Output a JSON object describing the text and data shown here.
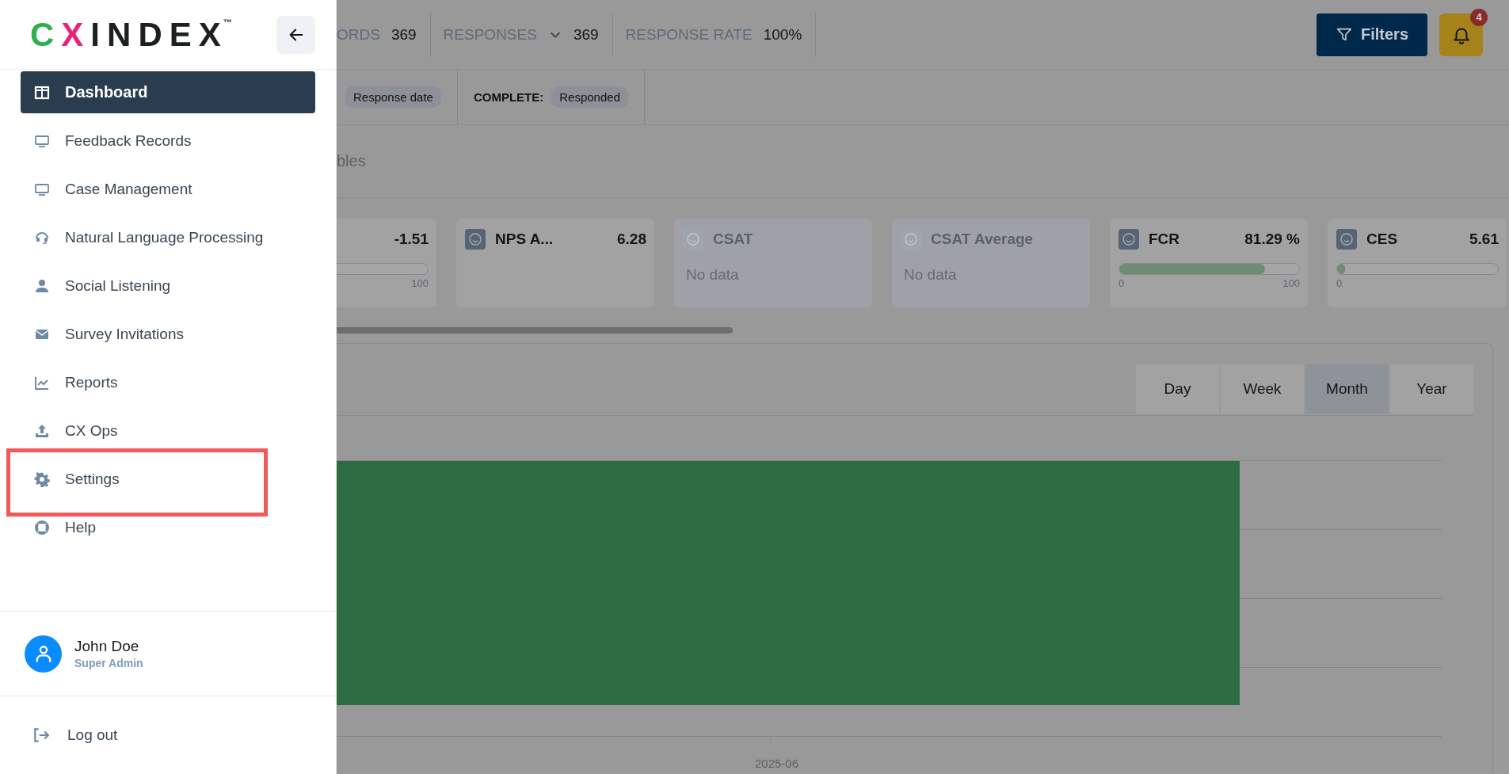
{
  "sidebar": {
    "logo": {
      "text": "CXINDEX",
      "mark": "™"
    },
    "nav": [
      {
        "label": "Dashboard",
        "selected": true,
        "highlighted": false
      },
      {
        "label": "Feedback Records",
        "selected": false,
        "highlighted": false
      },
      {
        "label": "Case Management",
        "selected": false,
        "highlighted": false
      },
      {
        "label": "Natural Language Processing",
        "selected": false,
        "highlighted": false
      },
      {
        "label": "Social Listening",
        "selected": false,
        "highlighted": false
      },
      {
        "label": "Survey Invitations",
        "selected": false,
        "highlighted": false
      },
      {
        "label": "Reports",
        "selected": false,
        "highlighted": false
      },
      {
        "label": "CX Ops",
        "selected": false,
        "highlighted": false
      },
      {
        "label": "Settings",
        "selected": false,
        "highlighted": true
      },
      {
        "label": "Help",
        "selected": false,
        "highlighted": false
      }
    ],
    "user": {
      "name": "John Doe",
      "role": "Super Admin"
    },
    "logout": "Log out"
  },
  "topbar": {
    "stats": [
      {
        "label": "ORDS",
        "value": "369",
        "dropdown": false
      },
      {
        "label": "RESPONSES",
        "value": "369",
        "dropdown": true
      },
      {
        "label": "RESPONSE RATE",
        "value": "100%",
        "dropdown": false
      }
    ],
    "filters": "Filters",
    "notifications": "4"
  },
  "filter_bar": [
    {
      "value": "Response date"
    },
    {
      "label": "COMPLETE:",
      "value": "Responded"
    }
  ],
  "tab_fragment": "bles",
  "kpis": [
    {
      "kind": "gauge",
      "value": "-1.51",
      "max_label": "100"
    },
    {
      "kind": "value",
      "title": "NPS A...",
      "value": "6.28"
    },
    {
      "kind": "no_data",
      "title": "CSAT",
      "message": "No data"
    },
    {
      "kind": "no_data",
      "title": "CSAT Average",
      "message": "No data"
    },
    {
      "kind": "gauge",
      "title": "FCR",
      "value": "81.29 %",
      "level": 0.81,
      "min_label": "0",
      "max_label": "100"
    },
    {
      "kind": "gauge",
      "title": "CES",
      "value": "5.61",
      "level": 0.03,
      "min_label": "0"
    }
  ],
  "periods": [
    {
      "label": "Day",
      "selected": false
    },
    {
      "label": "Week",
      "selected": false
    },
    {
      "label": "Month",
      "selected": true
    },
    {
      "label": "Year",
      "selected": false
    }
  ],
  "chart": {
    "x_label": "2025-06"
  }
}
